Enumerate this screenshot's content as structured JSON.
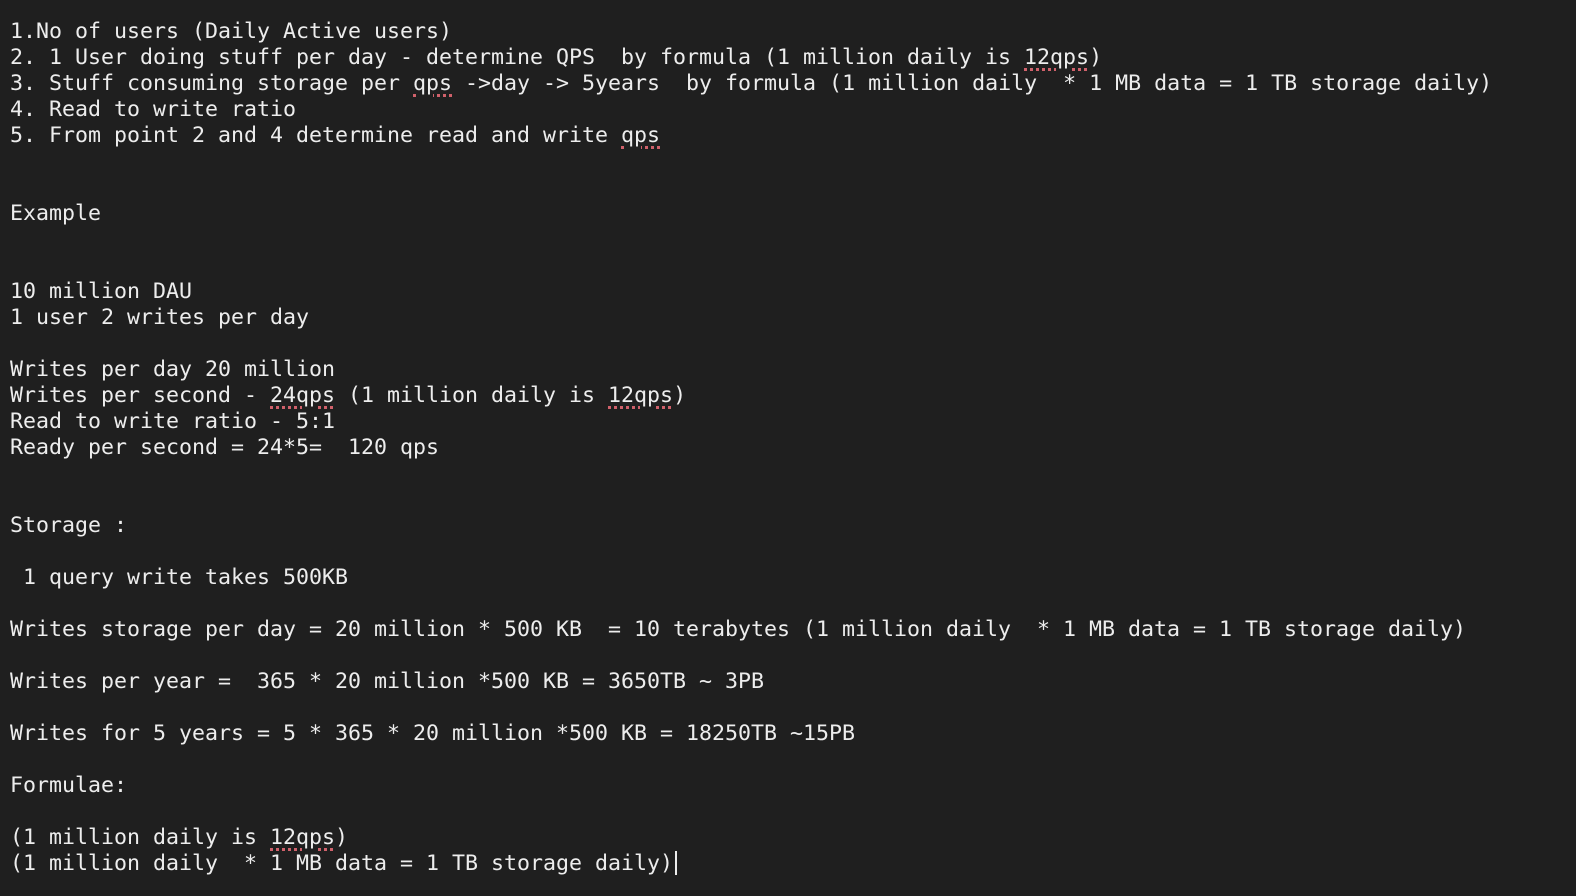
{
  "note": {
    "lines": [
      [
        {
          "t": "1.No of users (Daily Active users)"
        }
      ],
      [
        {
          "t": "2. 1 User doing stuff per day - determine QPS  by formula (1 million daily is "
        },
        {
          "t": "12qps",
          "sp": true
        },
        {
          "t": ")"
        }
      ],
      [
        {
          "t": "3. Stuff consuming storage per "
        },
        {
          "t": "qps",
          "sp": true
        },
        {
          "t": " ->day -> 5years  by formula (1 million daily  * 1 MB data = 1 TB storage daily)"
        }
      ],
      [
        {
          "t": "4. Read to write ratio"
        }
      ],
      [
        {
          "t": "5. From point 2 and 4 determine read and write "
        },
        {
          "t": "qps",
          "sp": true
        }
      ],
      [],
      [],
      [
        {
          "t": "Example"
        }
      ],
      [],
      [],
      [
        {
          "t": "10 million DAU"
        }
      ],
      [
        {
          "t": "1 user 2 writes per day"
        }
      ],
      [],
      [
        {
          "t": "Writes per day 20 million"
        }
      ],
      [
        {
          "t": "Writes per second - "
        },
        {
          "t": "24qps",
          "sp": true
        },
        {
          "t": " (1 million daily is "
        },
        {
          "t": "12qps",
          "sp": true
        },
        {
          "t": ")"
        }
      ],
      [
        {
          "t": "Read to write ratio - 5:1"
        }
      ],
      [
        {
          "t": "Ready per second = 24*5=  120 qps"
        }
      ],
      [],
      [],
      [
        {
          "t": "Storage :"
        }
      ],
      [],
      [
        {
          "t": " 1 query write takes 500KB"
        }
      ],
      [],
      [
        {
          "t": "Writes storage per day = 20 million * 500 KB  = 10 terabytes (1 million daily  * 1 MB data = 1 TB storage daily)"
        }
      ],
      [],
      [
        {
          "t": "Writes per year =  365 * 20 million *500 KB = 3650TB ~ 3PB"
        }
      ],
      [],
      [
        {
          "t": "Writes for 5 years = 5 * 365 * 20 million *500 KB = 18250TB ~15PB"
        }
      ],
      [],
      [
        {
          "t": "Formulae:"
        }
      ],
      [],
      [
        {
          "t": "(1 million daily is "
        },
        {
          "t": "12qps",
          "sp": true
        },
        {
          "t": ")"
        }
      ],
      [
        {
          "t": "(1 million daily  * 1 MB data = 1 TB storage daily)"
        }
      ]
    ]
  },
  "colors": {
    "background": "#1f1f1f",
    "text": "#ededed",
    "spellcheck_underline": "#d0616b"
  }
}
